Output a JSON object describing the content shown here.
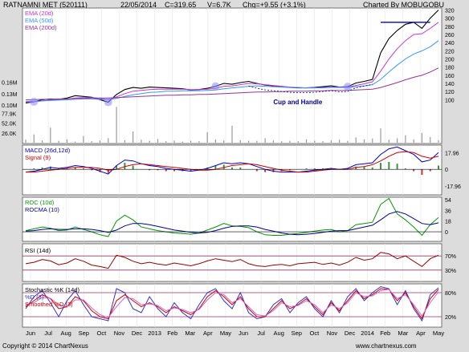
{
  "header": {
    "symbol": "RATNAMNI MET (520111)",
    "date": "22/05/2014",
    "close": "C=319.65",
    "volume": "V=6.7K",
    "change": "Chg=+9.55 (+3.1%)",
    "charted_by": "Charted By MOBUGOBU"
  },
  "footer": {
    "copyright": "Copyright © 2014 ChartNexus",
    "website": "www.chartnexus.com"
  },
  "colors": {
    "price": "#000000",
    "ema20": "#cc33cc",
    "ema50": "#3399ff",
    "ema200": "#993399",
    "volume": "#999999",
    "macd": "#0000cc",
    "signal": "#cc0000",
    "roc": "#009900",
    "rocma": "#000099",
    "rsi": "#990000",
    "stoch_k": "#3333cc",
    "stoch_d": "#cc0000",
    "annotation": "#000099",
    "circle": "#8888ff"
  },
  "chart_data": [
    {
      "type": "line",
      "panel": "price",
      "legend": [
        "EMA (20d)",
        "EMA (50d)",
        "EMA (200d)"
      ],
      "y_ticks": [
        "320",
        "300",
        "280",
        "260",
        "240",
        "220",
        "200",
        "180",
        "160",
        "140",
        "120",
        "100"
      ],
      "ylim": [
        85,
        325
      ],
      "x": [
        0,
        1,
        2,
        3,
        4,
        5,
        6,
        7,
        8,
        9,
        10,
        11,
        12,
        13,
        14,
        15,
        16,
        17,
        18,
        19,
        20,
        21,
        22,
        23,
        24,
        25,
        26,
        27,
        28,
        29,
        30,
        31,
        32,
        33,
        34,
        35,
        36,
        37,
        38,
        39,
        40,
        41,
        42,
        43,
        44,
        45,
        46,
        47,
        48,
        49,
        50
      ],
      "series": [
        {
          "name": "Price",
          "values": [
            92,
            95,
            100,
            102,
            101,
            104,
            110,
            108,
            106,
            100,
            94,
            113,
            125,
            130,
            128,
            131,
            130,
            129,
            128,
            127,
            124,
            125,
            128,
            133,
            140,
            138,
            142,
            145,
            140,
            136,
            134,
            132,
            130,
            129,
            129,
            130,
            132,
            134,
            131,
            132,
            141,
            145,
            150,
            215,
            250,
            270,
            285,
            290,
            275,
            300,
            320
          ]
        },
        {
          "name": "EMA (20d)",
          "values": [
            94,
            95,
            97,
            99,
            100,
            101,
            104,
            105,
            105,
            103,
            100,
            107,
            115,
            121,
            123,
            125,
            126,
            126,
            126,
            126,
            125,
            125,
            126,
            128,
            133,
            134,
            137,
            140,
            139,
            137,
            135,
            133,
            131,
            130,
            129,
            129,
            130,
            131,
            131,
            131,
            135,
            139,
            144,
            170,
            200,
            225,
            245,
            260,
            262,
            275,
            290
          ]
        },
        {
          "name": "EMA (50d)",
          "values": [
            96,
            96,
            97,
            98,
            99,
            100,
            101,
            102,
            102,
            101,
            100,
            103,
            108,
            112,
            115,
            118,
            119,
            121,
            121,
            122,
            122,
            122,
            123,
            124,
            127,
            129,
            131,
            133,
            134,
            133,
            132,
            131,
            130,
            130,
            129,
            129,
            129,
            130,
            130,
            130,
            132,
            134,
            137,
            150,
            168,
            185,
            200,
            212,
            220,
            230,
            245
          ]
        },
        {
          "name": "EMA (200d)",
          "values": [
            100,
            100,
            101,
            101,
            102,
            102,
            103,
            103,
            104,
            104,
            104,
            105,
            106,
            107,
            108,
            109,
            110,
            111,
            111,
            112,
            112,
            113,
            113,
            114,
            115,
            116,
            117,
            118,
            119,
            119,
            120,
            120,
            121,
            121,
            121,
            122,
            122,
            123,
            123,
            123,
            124,
            125,
            126,
            130,
            136,
            142,
            149,
            155,
            160,
            168,
            178
          ]
        }
      ],
      "annotations": [
        "Cup and Handle"
      ]
    },
    {
      "type": "bar",
      "panel": "volume",
      "y_ticks": [
        "0.16M",
        "0.13M",
        "0.10M",
        "77.9K",
        "52.0K",
        "26.0K"
      ],
      "ylim": [
        0,
        170000
      ],
      "values": [
        8000,
        22000,
        6000,
        40000,
        5000,
        9000,
        3000,
        18000,
        4000,
        6000,
        12000,
        95000,
        7000,
        30000,
        8000,
        5000,
        10000,
        4000,
        6000,
        3000,
        5000,
        4000,
        28000,
        9000,
        6000,
        45000,
        7000,
        5000,
        5000,
        12000,
        6000,
        4000,
        5000,
        4000,
        9000,
        5000,
        4000,
        6000,
        8000,
        5000,
        14000,
        9000,
        11000,
        38000,
        8000,
        12000,
        20000,
        9000,
        26000,
        15000,
        6700
      ]
    },
    {
      "type": "line",
      "panel": "macd",
      "legend": [
        "MACD (26d,12d)",
        "Signal (9)"
      ],
      "y_ticks": [
        "17.96",
        "0",
        "-17.96"
      ],
      "ylim": [
        -24,
        26
      ],
      "series": [
        {
          "name": "MACD (26d,12d)",
          "values": [
            -3,
            -2,
            0,
            2,
            1,
            2,
            4,
            3,
            1,
            -2,
            -5,
            4,
            10,
            9,
            6,
            4,
            3,
            1,
            0,
            -1,
            -2,
            -1,
            1,
            4,
            7,
            6,
            7,
            6,
            3,
            0,
            -2,
            -3,
            -3,
            -3,
            -2,
            -1,
            0,
            1,
            0,
            1,
            5,
            6,
            7,
            16,
            22,
            24,
            20,
            16,
            8,
            10,
            18
          ]
        },
        {
          "name": "Signal (9)",
          "values": [
            -3,
            -3,
            -2,
            -1,
            0,
            1,
            2,
            2,
            2,
            1,
            -1,
            0,
            3,
            5,
            6,
            5,
            4,
            3,
            2,
            1,
            0,
            -1,
            -1,
            0,
            2,
            4,
            5,
            6,
            5,
            3,
            1,
            -1,
            -2,
            -3,
            -3,
            -2,
            -1,
            0,
            0,
            0,
            2,
            3,
            5,
            9,
            14,
            18,
            19,
            18,
            14,
            12,
            14
          ]
        }
      ]
    },
    {
      "type": "line",
      "panel": "roc",
      "legend": [
        "ROC (10d)",
        "ROCMA (10)"
      ],
      "y_ticks": [
        "54",
        "36",
        "18",
        "0"
      ],
      "ylim": [
        -12,
        58
      ],
      "series": [
        {
          "name": "ROC (10d)",
          "values": [
            2,
            5,
            8,
            6,
            2,
            3,
            8,
            4,
            0,
            -5,
            -8,
            18,
            28,
            20,
            8,
            5,
            2,
            0,
            -2,
            -3,
            -4,
            -2,
            3,
            8,
            14,
            10,
            9,
            7,
            0,
            -5,
            -6,
            -6,
            -4,
            -3,
            -1,
            1,
            3,
            4,
            0,
            2,
            12,
            14,
            16,
            46,
            56,
            30,
            20,
            8,
            -6,
            12,
            24
          ]
        },
        {
          "name": "ROCMA (10)",
          "values": [
            1,
            2,
            4,
            5,
            4,
            4,
            5,
            5,
            4,
            2,
            -1,
            3,
            10,
            14,
            14,
            12,
            9,
            6,
            3,
            1,
            -1,
            -2,
            -1,
            2,
            6,
            9,
            10,
            10,
            8,
            4,
            1,
            -2,
            -4,
            -5,
            -4,
            -3,
            -1,
            1,
            2,
            2,
            5,
            8,
            11,
            20,
            30,
            34,
            30,
            22,
            14,
            12,
            15
          ]
        }
      ]
    },
    {
      "type": "line",
      "panel": "rsi",
      "legend": [
        "RSI (14d)"
      ],
      "y_ticks": [
        "70%",
        "30%"
      ],
      "ylim": [
        0,
        100
      ],
      "series": [
        {
          "name": "RSI (14d)",
          "values": [
            48,
            52,
            60,
            56,
            45,
            50,
            62,
            55,
            44,
            40,
            35,
            72,
            66,
            55,
            48,
            52,
            47,
            44,
            50,
            46,
            42,
            48,
            56,
            62,
            58,
            54,
            60,
            48,
            42,
            40,
            44,
            46,
            42,
            48,
            50,
            52,
            46,
            50,
            44,
            52,
            66,
            58,
            62,
            80,
            76,
            62,
            70,
            55,
            40,
            62,
            72
          ]
        }
      ]
    },
    {
      "type": "line",
      "panel": "stochastic",
      "legend": [
        "Stochastic %K (14d)",
        "%D (3)",
        "Smoothed %D (3)"
      ],
      "y_ticks": [
        "80%",
        "20%"
      ],
      "ylim": [
        0,
        100
      ],
      "series": [
        {
          "name": "%K",
          "values": [
            40,
            70,
            85,
            55,
            20,
            60,
            85,
            50,
            20,
            15,
            10,
            90,
            80,
            40,
            30,
            70,
            40,
            20,
            55,
            30,
            15,
            50,
            80,
            90,
            60,
            40,
            80,
            30,
            15,
            20,
            50,
            65,
            30,
            55,
            70,
            40,
            20,
            60,
            30,
            70,
            90,
            60,
            80,
            95,
            90,
            50,
            85,
            40,
            10,
            75,
            92
          ]
        },
        {
          "name": "%D (3)",
          "values": [
            45,
            60,
            75,
            65,
            40,
            45,
            70,
            60,
            35,
            20,
            15,
            60,
            75,
            60,
            45,
            55,
            45,
            30,
            45,
            35,
            25,
            40,
            70,
            85,
            70,
            50,
            70,
            40,
            20,
            20,
            40,
            60,
            40,
            50,
            65,
            45,
            25,
            55,
            35,
            60,
            85,
            65,
            75,
            90,
            88,
            60,
            80,
            45,
            15,
            65,
            88
          ]
        },
        {
          "name": "Smoothed %D (3)",
          "values": [
            50,
            55,
            68,
            66,
            50,
            45,
            62,
            62,
            42,
            25,
            18,
            45,
            68,
            65,
            50,
            52,
            48,
            35,
            42,
            38,
            30,
            38,
            62,
            80,
            75,
            55,
            65,
            45,
            25,
            22,
            35,
            55,
            45,
            48,
            60,
            50,
            30,
            50,
            40,
            55,
            80,
            70,
            72,
            85,
            88,
            65,
            75,
            50,
            22,
            55,
            82
          ]
        }
      ]
    }
  ],
  "x_axis": {
    "labels": [
      "Jun",
      "Jul",
      "Aug",
      "Sep",
      "Oct",
      "Nov",
      "Dec",
      "2013",
      "Feb",
      "Mar",
      "Apr",
      "May",
      "Jun",
      "Jul",
      "Aug",
      "Sep",
      "Oct",
      "Nov",
      "Dec",
      "2014",
      "Feb",
      "Mar",
      "Apr",
      "May"
    ]
  }
}
